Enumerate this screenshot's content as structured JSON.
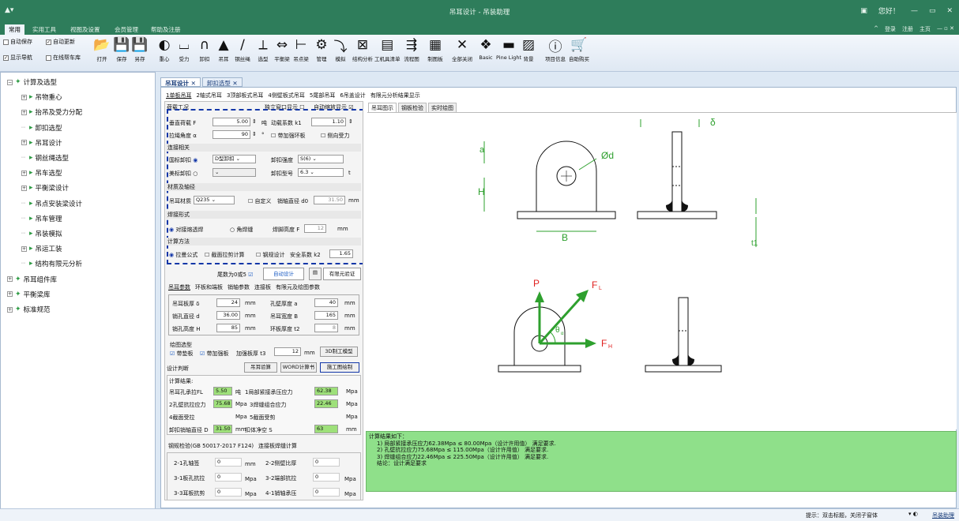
{
  "window": {
    "title": "吊耳设计 - 吊装助理",
    "user": "您好！",
    "controls": [
      "—",
      "▭",
      "✕"
    ]
  },
  "menu": {
    "items": [
      "常用",
      "实用工具",
      "视图及设置",
      "会员管理",
      "帮助及注册"
    ],
    "active": 0,
    "right": [
      "登录",
      "注册",
      "主页"
    ]
  },
  "ribbon": {
    "checks": [
      {
        "label": "自动保存",
        "checked": false
      },
      {
        "label": "自动更新",
        "checked": true
      },
      {
        "label": "显示导航",
        "checked": true
      },
      {
        "label": "在线帮车库",
        "checked": false
      }
    ],
    "buttons": [
      "打开",
      "保存",
      "另存",
      "重心",
      "受力",
      "卸扣",
      "吊耳",
      "钢丝绳",
      "选型",
      "平衡梁",
      "吊点梁",
      "管理",
      "模拟",
      "结构分析",
      "工机具清单",
      "流程图",
      "制图板",
      "全部关闭",
      "Basic",
      "Pine Light",
      "背景",
      "项目信息",
      "自助购买"
    ]
  },
  "tree": {
    "items": [
      {
        "label": "计算及选型",
        "level": 0,
        "toggle": "⊟"
      },
      {
        "label": "吊物重心",
        "level": 1,
        "toggle": "⊞"
      },
      {
        "label": "抬吊及受力分配",
        "level": 1,
        "toggle": "⊞"
      },
      {
        "label": "卸扣选型",
        "level": 1,
        "toggle": ""
      },
      {
        "label": "吊耳设计",
        "level": 1,
        "toggle": "⊞"
      },
      {
        "label": "钢丝绳选型",
        "level": 1,
        "toggle": ""
      },
      {
        "label": "吊车选型",
        "level": 1,
        "toggle": "⊞"
      },
      {
        "label": "平衡梁设计",
        "level": 1,
        "toggle": "⊞"
      },
      {
        "label": "吊点安装梁设计",
        "level": 1,
        "toggle": ""
      },
      {
        "label": "吊车管理",
        "level": 1,
        "toggle": ""
      },
      {
        "label": "吊装模拟",
        "level": 1,
        "toggle": ""
      },
      {
        "label": "吊运工装",
        "level": 1,
        "toggle": "⊞"
      },
      {
        "label": "结构有限元分析",
        "level": 1,
        "toggle": ""
      },
      {
        "label": "吊耳组件库",
        "level": 0,
        "toggle": "⊞"
      },
      {
        "label": "平衡梁库",
        "level": 0,
        "toggle": "⊞"
      },
      {
        "label": "标准规范",
        "level": 0,
        "toggle": "⊞"
      }
    ]
  },
  "doc_tabs": [
    {
      "label": "吊耳设计",
      "close": "✕"
    },
    {
      "label": "卸扣选型",
      "close": "✕"
    }
  ],
  "sub_tabs": [
    "1单板吊耳",
    "2轴式吊耳",
    "3顶部板式吊耳",
    "4侧壁板式吊耳",
    "5尾部吊耳",
    "6吊盖设计",
    "有限元分析结果显示"
  ],
  "form": {
    "top": {
      "left": "荷载工况",
      "independent": "独立窗口显示",
      "auto": "自动缩放显示"
    },
    "load": {
      "vertical_label": "垂直荷载 F",
      "vertical": "5.00",
      "unit_t": "吨",
      "dyn_label": "动载系数 k1",
      "dyn": "1.10",
      "angle_label": "拉绳角度 α",
      "angle": "90",
      "deg": "°",
      "stiff": "带加强环板",
      "side": "侧向受力"
    },
    "conn": {
      "title": "连接相关",
      "gb": "国标卸扣",
      "type": "D型卸扣",
      "strength_label": "卸扣强度",
      "strength": "S(6)",
      "am": "美标卸扣",
      "model_label": "卸扣型号",
      "model": "6.3",
      "t": "t"
    },
    "mat": {
      "title": "材质及轴径",
      "label": "吊耳材质",
      "value": "Q235",
      "custom": "自定义",
      "pin_label": "销轴直径 d0",
      "pin": "31.50",
      "mm": "mm"
    },
    "weld": {
      "title": "焊接形式",
      "opt1": "对接熔透焊",
      "opt2": "角焊缝",
      "fillet_label": "焊脚高度 F",
      "fillet": "12",
      "mm": "mm"
    },
    "method": {
      "title": "计算方法",
      "opt1": "拉曼公式",
      "opt2": "截面拉剪计算",
      "opt3": "钢规设计",
      "safety_label": "安全系数 k2",
      "safety": "1.65"
    },
    "auto": {
      "tail": "尾数为0或5",
      "btn": "自动设计",
      "fea": "有限元验证"
    },
    "param_tabs": [
      "吊耳参数",
      "环板和端板",
      "销轴参数",
      "连接板",
      "有限元及绘图参数"
    ],
    "params": [
      {
        "label": "吊耳板厚 δ",
        "value": "24",
        "unit": "mm",
        "label2": "孔壁厚度 a",
        "value2": "40",
        "unit2": "mm"
      },
      {
        "label": "销孔直径 d",
        "value": "36.00",
        "unit": "mm",
        "label2": "吊耳宽度 B",
        "value2": "165",
        "unit2": "mm"
      },
      {
        "label": "销孔高度 H",
        "value": "85",
        "unit": "mm",
        "label2": "环板厚度 t2",
        "value2": "8",
        "unit2": "mm"
      }
    ],
    "draw": {
      "title": "绘图选型",
      "pad": "带垫板",
      "stiff": "带加强板",
      "stiff_t": "加强板厚 t3",
      "t3": "12",
      "mm": "mm",
      "btn3d": "3D制工模型"
    },
    "judge": {
      "title": "设计判断",
      "check": "吊耳验算",
      "word": "WORD计算书",
      "draw": "施工图绘制"
    },
    "results": {
      "title": "计算结果:",
      "r1l": "吊耳孔承拉FL",
      "r1": "5.50",
      "r1u": "吨",
      "r1bl": "1局部紧接承压应力",
      "r1b": "62.38",
      "r1bu": "Mpa",
      "r2l": "2孔壁抗拉应力",
      "r2": "75.68",
      "r2u": "Mpa",
      "r2bl": "3焊缝组合应力",
      "r2b": "22.46",
      "r2bu": "Mpa",
      "r3l": "4截面受拉",
      "r3u": "Mpa",
      "r3bl": "5截面受剪",
      "r3bu": "Mpa",
      "r4l": "卸扣销轴直径 D",
      "r4": "31.50",
      "r4u": "mm",
      "r4bl": "扣体净空 S",
      "r4b": "63",
      "r4bu": "mm"
    },
    "steel": {
      "title": "钢规检验(GB 50017-2017 F124)",
      "sub": "连接板焊缝计算",
      "rows": [
        [
          "2-1孔轴签",
          "0",
          "mm",
          "2-2侧壁比厚",
          "0",
          ""
        ],
        [
          "3-1板孔抗拉",
          "0",
          "Mpa",
          "3-2端部抗拉",
          "0",
          "Mpa"
        ],
        [
          "3-3耳板抗剪",
          "0",
          "Mpa",
          "4-1销轴承压",
          "0",
          "Mpa"
        ]
      ]
    }
  },
  "view_tabs": [
    "吊耳图示",
    "钢板检验",
    "实时绘图"
  ],
  "dim_labels": {
    "delta": "δ",
    "a": "a",
    "d": "Ød",
    "H": "H",
    "B": "B",
    "t1": "t1",
    "P": "P",
    "FL": "F",
    "FLs": "L",
    "FH": "F",
    "FHs": "H",
    "theta": "θ",
    "thetas": "α"
  },
  "result": {
    "lines": [
      "计算结果如下：",
      "  1) 局部紧接承压应力62.38Mpa ≤ 80.00Mpa（设计许用值）  满足要求.",
      "  2) 孔壁抗拉应力75.68Mpa ≤ 115.00Mpa（设计许用值）  满足要求.",
      "  3) 焊缝组合应力22.46Mpa ≤ 225.50Mpa（设计许用值）  满足要求.",
      "  结论：设计满足要求"
    ]
  },
  "status": {
    "hint": "提示：双击标题，关闭子窗体",
    "link": "吊装助理"
  },
  "colors": {
    "title_bg": "#2e7d5b",
    "accent": "#163a78",
    "result_bg": "#8fe08a",
    "dim": "#2ea02e",
    "force": "#e0201f"
  }
}
